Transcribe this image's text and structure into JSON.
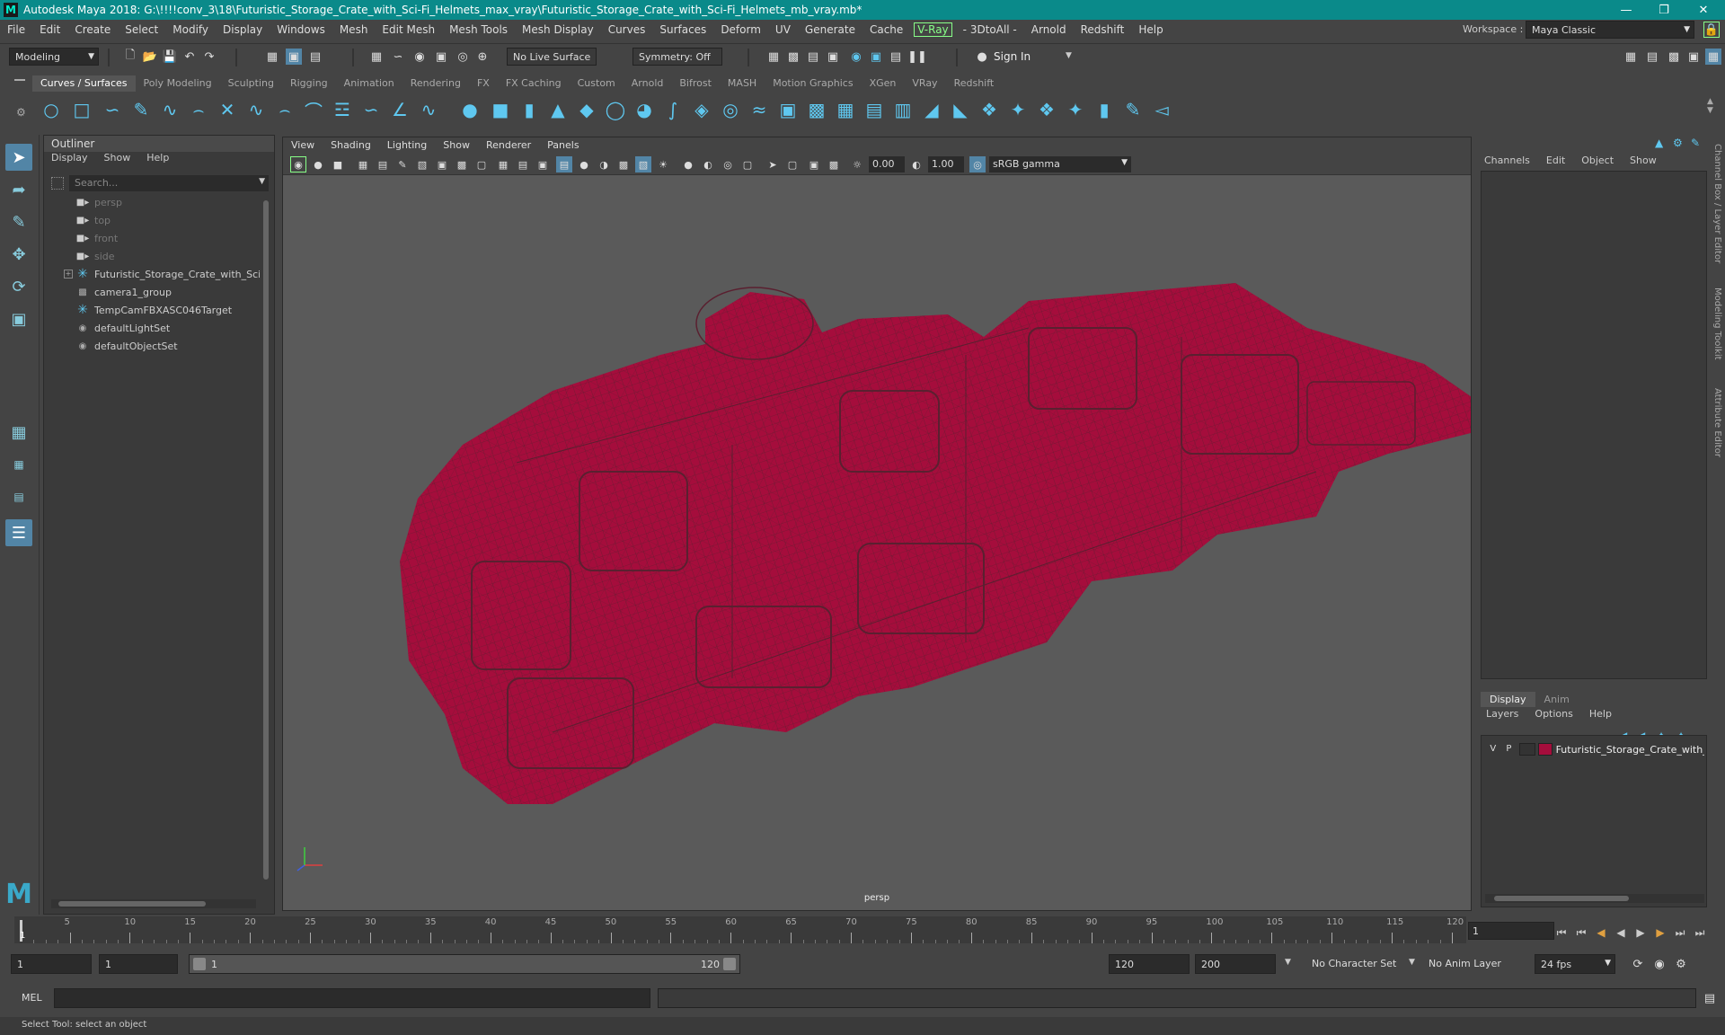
{
  "window": {
    "title": "Autodesk Maya 2018: G:\\!!!!conv_3\\18\\Futuristic_Storage_Crate_with_Sci-Fi_Helmets_max_vray\\Futuristic_Storage_Crate_with_Sci-Fi_Helmets_mb_vray.mb*",
    "logo": "M"
  },
  "menubar": {
    "items": [
      "File",
      "Edit",
      "Create",
      "Select",
      "Modify",
      "Display",
      "Windows",
      "Mesh",
      "Edit Mesh",
      "Mesh Tools",
      "Mesh Display",
      "Curves",
      "Surfaces",
      "Deform",
      "UV",
      "Generate",
      "Cache"
    ],
    "vray": "V-Ray",
    "items2": [
      "- 3DtoAll -",
      "Arnold",
      "Redshift",
      "Help"
    ],
    "workspace_label": "Workspace :",
    "workspace_value": "Maya Classic"
  },
  "toolbar": {
    "mode": "Modeling",
    "live_surface": "No Live Surface",
    "symmetry": "Symmetry: Off",
    "sign_in": "Sign In"
  },
  "shelf": {
    "tabs": [
      "Curves / Surfaces",
      "Poly Modeling",
      "Sculpting",
      "Rigging",
      "Animation",
      "Rendering",
      "FX",
      "FX Caching",
      "Custom",
      "Arnold",
      "Bifrost",
      "MASH",
      "Motion Graphics",
      "XGen",
      "VRay",
      "Redshift"
    ],
    "active_tab": "Curves / Surfaces"
  },
  "outliner": {
    "title": "Outliner",
    "menu": [
      "Display",
      "Show",
      "Help"
    ],
    "search_placeholder": "Search...",
    "items": [
      {
        "label": "persp",
        "icon": "camera-icon",
        "dim": true
      },
      {
        "label": "top",
        "icon": "camera-icon",
        "dim": true
      },
      {
        "label": "front",
        "icon": "camera-icon",
        "dim": true
      },
      {
        "label": "side",
        "icon": "camera-icon",
        "dim": true
      },
      {
        "label": "Futuristic_Storage_Crate_with_Sci_Fi_",
        "icon": "transform-icon",
        "dim": false,
        "expandable": true
      },
      {
        "label": "camera1_group",
        "icon": "group-icon",
        "dim": false
      },
      {
        "label": "TempCamFBXASC046Target",
        "icon": "transform-icon",
        "dim": false
      },
      {
        "label": "defaultLightSet",
        "icon": "set-icon",
        "dim": false
      },
      {
        "label": "defaultObjectSet",
        "icon": "set-icon",
        "dim": false
      }
    ]
  },
  "viewport": {
    "menu": [
      "View",
      "Shading",
      "Lighting",
      "Show",
      "Renderer",
      "Panels"
    ],
    "exposure": "0.00",
    "gamma": "1.00",
    "color_space": "sRGB gamma",
    "camera": "persp",
    "wire_color": "#a50d3c"
  },
  "channel_box": {
    "menu": [
      "Channels",
      "Edit",
      "Object",
      "Show"
    ],
    "layer_tabs": [
      "Display",
      "Anim"
    ],
    "layer_menu": [
      "Layers",
      "Options",
      "Help"
    ],
    "layer": {
      "v": "V",
      "p": "P",
      "name": "Futuristic_Storage_Crate_with_",
      "color": "#a50d3c"
    },
    "side_tabs": [
      "Channel Box / Layer Editor",
      "Modeling Toolkit",
      "Attribute Editor"
    ]
  },
  "timeline": {
    "ticks": [
      "5",
      "10",
      "15",
      "20",
      "25",
      "30",
      "35",
      "40",
      "45",
      "50",
      "55",
      "60",
      "65",
      "70",
      "75",
      "80",
      "85",
      "90",
      "95",
      "100",
      "105",
      "110",
      "115",
      "120"
    ],
    "start_marker": "1",
    "current_frame": "1"
  },
  "range": {
    "start": "1",
    "playback_start": "1",
    "slider_start": "1",
    "slider_end": "120",
    "playback_end": "120",
    "end": "200",
    "character_set": "No Character Set",
    "anim_layer": "No Anim Layer",
    "fps": "24 fps"
  },
  "command": {
    "label": "MEL"
  },
  "status": {
    "text": "Select Tool: select an object"
  }
}
